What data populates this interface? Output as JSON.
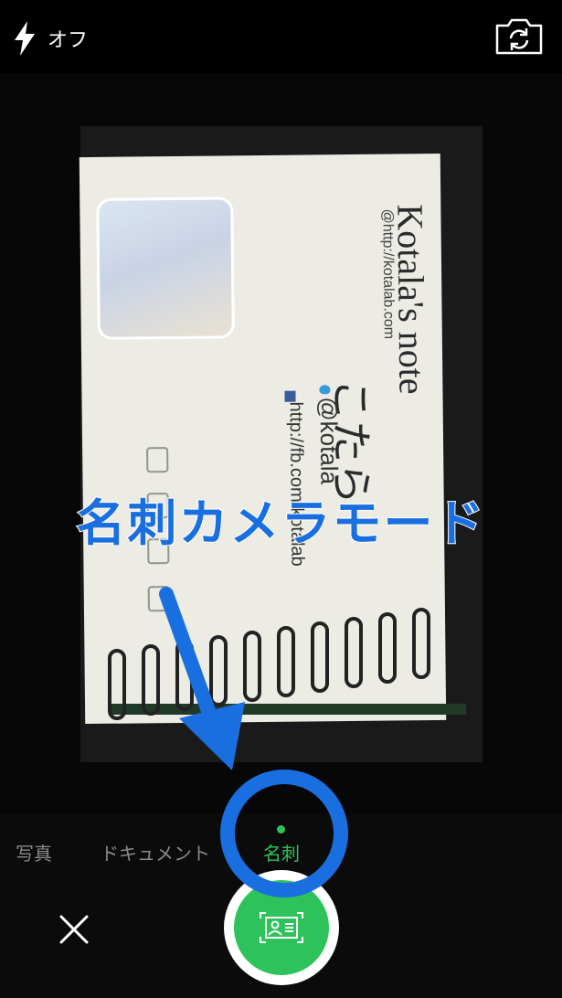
{
  "top_bar": {
    "flash_label": "オフ"
  },
  "card": {
    "name_title": "Kotala's note",
    "url": "@http://kotalab.com",
    "jp_name": "こたら",
    "twitter": "@kotala",
    "facebook": "http://fb.com/kotalab"
  },
  "annotation": {
    "label": "名刺カメラモード"
  },
  "modes": {
    "photo": "写真",
    "document": "ドキュメント",
    "card": "名刺"
  },
  "colors": {
    "accent_green": "#2ec35a",
    "annotation_blue": "#1a6fe0"
  }
}
